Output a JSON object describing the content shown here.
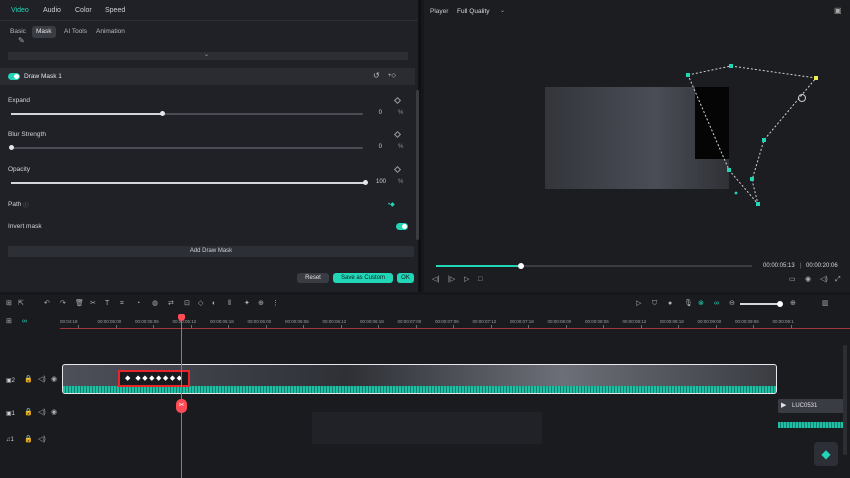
{
  "tabs": [
    {
      "label": "Video",
      "active": true
    },
    {
      "label": "Audio"
    },
    {
      "label": "Color"
    },
    {
      "label": "Speed"
    }
  ],
  "subtabs": [
    {
      "label": "Basic"
    },
    {
      "label": "Mask",
      "active": true
    },
    {
      "label": "AI Tools"
    },
    {
      "label": "Animation"
    }
  ],
  "mask": {
    "title": "Draw Mask 1"
  },
  "expand": {
    "label": "Expand",
    "value": "0",
    "unit": "%",
    "level": 0.43
  },
  "blur": {
    "label": "Blur Strength",
    "value": "0",
    "unit": "%",
    "level": 0.0
  },
  "opacity": {
    "label": "Opacity",
    "value": "100",
    "unit": "%",
    "level": 1.0
  },
  "path": {
    "label": "Path"
  },
  "invert": {
    "label": "Invert mask",
    "on": true
  },
  "add_mask": {
    "label": "Add Draw Mask"
  },
  "actions": {
    "reset": "Reset",
    "save": "Save as Custom",
    "ok": "OK"
  },
  "player": {
    "label": "Player",
    "quality": "Full Quality",
    "current_time": "00:00:05:13",
    "total_time": "00:00:20:06",
    "progress": 0.27
  },
  "timeline": {
    "ruler": [
      "00:04:18",
      "00:00:05:00",
      "00:00:05:06",
      "00:00:05:12",
      "00:00:05:18",
      "00:00:06:00",
      "00:00:06:06",
      "00:00:06:12",
      "00:00:06:18",
      "00:00:07:00",
      "00:00:07:06",
      "00:00:07:12",
      "00:00:07:18",
      "00:00:08:00",
      "00:00:08:06",
      "00:00:08:12",
      "00:00:08:18",
      "00:00:09:00",
      "00:00:09:06",
      "00:00:09:1"
    ],
    "tracks": [
      {
        "label": "2"
      },
      {
        "label": "1"
      },
      {
        "label": "1"
      }
    ],
    "clip_label": "LUC0531"
  },
  "colors": {
    "accent": "#21d5b7",
    "playhead": "#ff4b55",
    "highlight": "#e8242b"
  }
}
